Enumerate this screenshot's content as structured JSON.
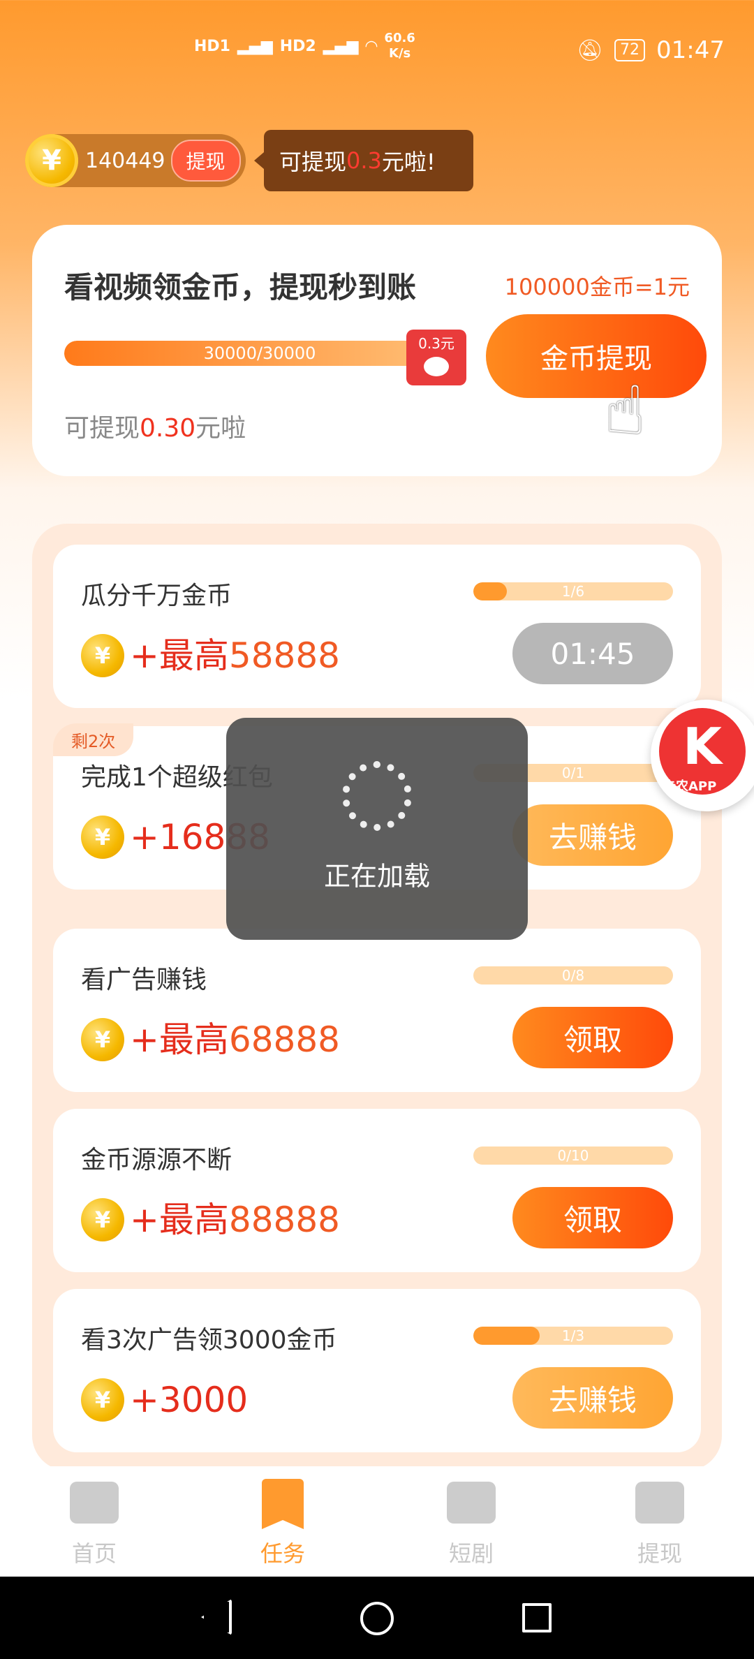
{
  "status_bar": {
    "signal_labels": [
      "HD1",
      "HD2"
    ],
    "net_speed_value": "60.6",
    "net_speed_unit": "K/s",
    "battery": "72",
    "time": "01:47"
  },
  "header": {
    "coin_symbol": "¥",
    "coin_count": "140449",
    "withdraw_label": "提现",
    "tip_prefix": "可提现",
    "tip_amount": "0.3",
    "tip_suffix": "元啦!"
  },
  "withdraw_card": {
    "title": "看视频领金币，提现秒到账",
    "rate": "100000金币=1元",
    "progress_text": "30000/30000",
    "progress_fraction": 1.0,
    "redpacket_amount": "0.3元",
    "button_label": "金币提现",
    "sub_prefix": "可提现",
    "sub_amount": "0.30",
    "sub_suffix": "元啦"
  },
  "tasks": [
    {
      "title": "瓜分千万金币",
      "progress_text": "1/6",
      "progress": 0.1667,
      "reward_prefix": "+最高",
      "reward": "58888",
      "button": "01:45",
      "button_style": "gray"
    },
    {
      "title": "完成1个超级红包",
      "progress_text": "0/1",
      "progress": 0.0,
      "reward_prefix": "+",
      "reward": "16888",
      "button": "去赚钱",
      "button_style": "light",
      "tag": "剩2次"
    },
    {
      "title": "看广告赚钱",
      "progress_text": "0/8",
      "progress": 0.0,
      "reward_prefix": "+最高",
      "reward": "68888",
      "button": "领取",
      "button_style": "orange"
    },
    {
      "title": "金币源源不断",
      "progress_text": "0/10",
      "progress": 0.0,
      "reward_prefix": "+最高",
      "reward": "88888",
      "button": "领取",
      "button_style": "orange"
    },
    {
      "title": "看3次广告领3000金币",
      "progress_text": "1/3",
      "progress": 0.3333,
      "reward_prefix": "+",
      "reward": "3000",
      "button": "去赚钱",
      "button_style": "light"
    }
  ],
  "float_logo": {
    "letter": "K",
    "caption": "卡农APP"
  },
  "loading": {
    "text": "正在加载"
  },
  "bottom_nav": [
    {
      "label": "首页",
      "icon": "video-camera-icon",
      "active": false
    },
    {
      "label": "任务",
      "icon": "bookmark-star-icon",
      "active": true
    },
    {
      "label": "短剧",
      "icon": "play-screen-icon",
      "active": false
    },
    {
      "label": "提现",
      "icon": "wallet-icon",
      "active": false
    }
  ],
  "colors": {
    "accent": "#ff9a2e",
    "reward_red": "#e52d1c",
    "button_orange": "#ff4a0a"
  }
}
